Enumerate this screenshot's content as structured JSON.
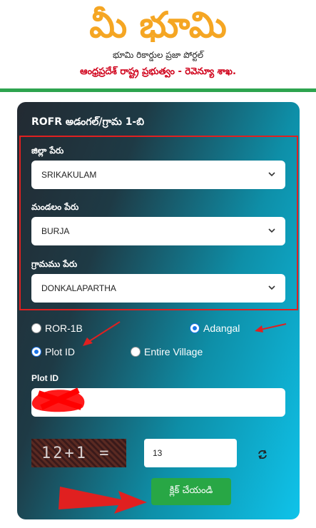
{
  "header": {
    "logo_text": "మీ భూమి",
    "subtitle": "భూమి రికార్డుల ప్రజా పోర్టల్",
    "department": "ఆంధ్రప్రదేశ్ రాష్ట్ర ప్రభుత్వం - రెవెన్యూ శాఖ."
  },
  "form": {
    "title": "ROFR అడంగల్/గ్రామ 1-బి",
    "district": {
      "label": "జిల్లా పేరు",
      "value": "SRIKAKULAM"
    },
    "mandal": {
      "label": "మండలం పేరు",
      "value": "BURJA"
    },
    "village": {
      "label": "గ్రామము పేరు",
      "value": "DONKALAPARTHA"
    },
    "report_type": {
      "options": [
        "ROR-1B",
        "Adangal"
      ],
      "selected": "Adangal"
    },
    "search_by": {
      "options": [
        "Plot ID",
        "Entire Village"
      ],
      "selected": "Plot ID"
    },
    "plot_id": {
      "label": "Plot ID",
      "value": ""
    },
    "captcha": {
      "text": "12+1 =",
      "answer": "13"
    },
    "submit_label": "క్లిక్ చేయండి"
  },
  "colors": {
    "logo": "#f5a623",
    "department_text": "#d0021b",
    "header_bar": "#2ea44f",
    "submit": "#28a745",
    "highlight": "#e02020",
    "radio_selected": "#1a73e8"
  }
}
